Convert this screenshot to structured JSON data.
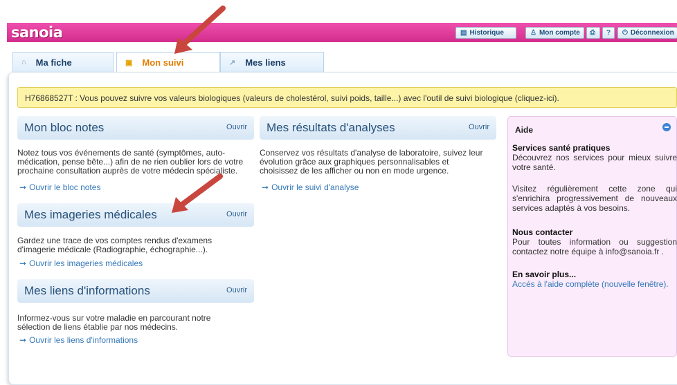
{
  "header": {
    "logo": "sanoia",
    "buttons": [
      {
        "icon": "▤",
        "label": "Historique"
      },
      {
        "icon": "♙",
        "label": "Mon compte"
      },
      {
        "icon": "⎙",
        "label": ""
      },
      {
        "icon": "?",
        "label": ""
      },
      {
        "icon": "⏻",
        "label": "Déconnexion"
      }
    ]
  },
  "tabs": [
    {
      "label": "Ma fiche",
      "icon": "home-icon",
      "active": false
    },
    {
      "label": "Mon suivi",
      "icon": "calendar-icon",
      "active": true
    },
    {
      "label": "Mes liens",
      "icon": "external-link-icon",
      "active": false
    }
  ],
  "notice": "H76868527T : Vous pouvez suivre vos valeurs biologiques (valeurs de cholestérol, suivi poids, taille...) avec l'outil de suivi biologique (cliquez-ici).",
  "open_label": "Ouvrir",
  "sections": {
    "bloc_notes": {
      "title": "Mon bloc notes",
      "lines": [
        "Notez tous vos événements de santé (symptômes, auto-",
        "médication, pense bête...) afin de ne rien oublier lors de votre",
        "prochaine consultation auprès de votre médecin spécialiste."
      ],
      "link": "Ouvrir le bloc notes"
    },
    "resultats": {
      "title": "Mes résultats d'analyses",
      "lines": [
        "Conservez vos résultats d'analyse de laboratoire, suivez leur",
        "évolution grâce aux graphiques personnalisables et",
        "choisissez de les afficher ou non en mode urgence."
      ],
      "link": "Ouvrir le suivi d'analyse"
    },
    "imageries": {
      "title": "Mes imageries médicales",
      "lines": [
        "Gardez une trace de vos comptes rendus d'examens",
        "d'imagerie médicale (Radiographie, échographie...)."
      ],
      "link": "Ouvrir les imageries médicales"
    },
    "liens": {
      "title": "Mes liens d'informations",
      "lines": [
        "Informez-vous sur votre maladie en parcourant notre",
        "sélection de liens établie par nos médecins."
      ],
      "link": "Ouvrir les liens d'informations"
    }
  },
  "aide": {
    "title": "Aide",
    "services_title": "Services santé pratiques",
    "services_text": "Découvrez nos services pour mieux suivre votre santé.",
    "zone_text": "Visitez régulièrement cette zone qui s'enrichira progressivement de nouveaux services adaptés à vos besoins.",
    "contact_title": "Nous contacter",
    "contact_text": "Pour toutes information ou suggestion contactez notre équipe à info@sanoia.fr .",
    "savoir_title": "En savoir plus...",
    "savoir_link": "Accés à l'aide complète (nouvelle fenêtre)."
  },
  "colors": {
    "header": "#e040a0",
    "tab_active_text": "#e47d00",
    "notice_bg": "#fdf4a8",
    "aide_bg": "#fcebfb",
    "arrow": "#c9463f"
  }
}
